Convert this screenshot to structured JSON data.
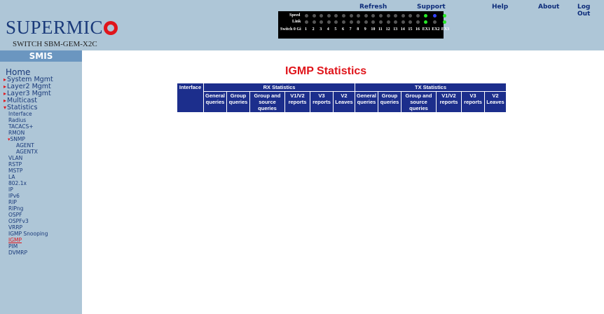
{
  "header": {
    "logo_text": "SUPERMIC",
    "switch_model": "SWITCH SBM-GEM-X2C",
    "nav": [
      "Refresh",
      "Support",
      "Help",
      "About",
      "Log Out"
    ]
  },
  "port_panel": {
    "speed_label": "Speed",
    "link_label": "Link",
    "switch_label": "Switch 0 Gi",
    "ports": [
      "1",
      "2",
      "3",
      "4",
      "5",
      "6",
      "7",
      "8",
      "9",
      "10",
      "11",
      "12",
      "13",
      "14",
      "15",
      "16",
      "EX1",
      "EX2",
      "EX3"
    ]
  },
  "sidebar": {
    "smis": "SMIS",
    "home": "Home",
    "menu": {
      "system": "System Mgmt",
      "layer2": "Layer2 Mgmt",
      "layer3": "Layer3 Mgmt",
      "multicast": "Multicast",
      "statistics": "Statistics"
    },
    "stats_items": {
      "interface": "Interface",
      "radius": "Radius",
      "tacacs": "TACACS+",
      "rmon": "RMON",
      "snmp": "SNMP",
      "agent": "AGENT",
      "agentx": "AGENTX",
      "vlan": "VLAN",
      "rstp": "RSTP",
      "mstp": "MSTP",
      "la": "LA",
      "dot1x": "802.1x",
      "ip": "IP",
      "ipv6": "IPv6",
      "rip": "RIP",
      "ripng": "RIPng",
      "ospf": "OSPF",
      "ospfv3": "OSPFv3",
      "vrrp": "VRRP",
      "igmp_snooping": "IGMP Snooping",
      "igmp": "IGMP",
      "pim": "PIM",
      "dvmrp": "DVMRP"
    }
  },
  "main": {
    "title": "IGMP Statistics",
    "table": {
      "interface": "Interface",
      "rx_group": "RX Statistics",
      "tx_group": "TX Statistics",
      "rx_columns": [
        "General queries",
        "Group queries",
        "Group and source queries",
        "V1/V2 reports",
        "V3 reports",
        "V2 Leaves"
      ],
      "tx_columns": [
        "General queries",
        "Group queries",
        "Group and source queries",
        "V1/V2 reports",
        "V3 reports",
        "V2 Leaves"
      ]
    }
  },
  "colors": {
    "header_bg": "#aec6d7",
    "smis_bar": "#6b96c0",
    "table_bg": "#1c2e8c",
    "accent_red": "#e0151b"
  }
}
